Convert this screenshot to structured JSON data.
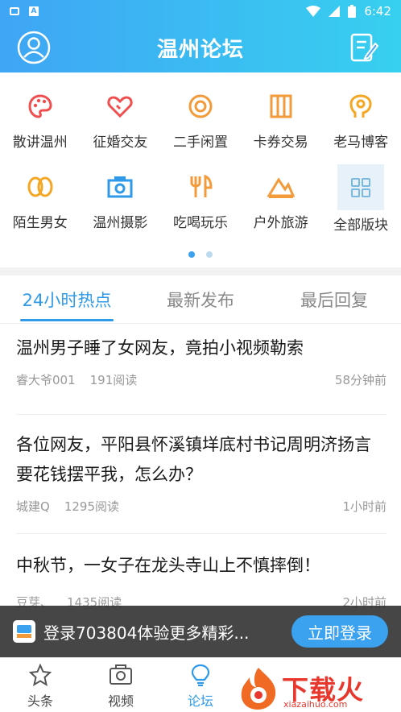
{
  "status_bar": {
    "time": "6:42"
  },
  "header": {
    "title": "温州论坛"
  },
  "categories": [
    {
      "label": "散讲温州",
      "icon": "palette-icon",
      "color": "#ef4f4f"
    },
    {
      "label": "征婚交友",
      "icon": "heart-icon",
      "color": "#ef4f4f"
    },
    {
      "label": "二手闲置",
      "icon": "target-icon",
      "color": "#f39a3b"
    },
    {
      "label": "卡券交易",
      "icon": "ticket-icon",
      "color": "#f39a3b"
    },
    {
      "label": "老马博客",
      "icon": "head-icon",
      "color": "#f5a623"
    },
    {
      "label": "陌生男女",
      "icon": "couple-icon",
      "color": "#f5a623"
    },
    {
      "label": "温州摄影",
      "icon": "camera-icon",
      "color": "#2e9ae9"
    },
    {
      "label": "吃喝玩乐",
      "icon": "fork-knife-icon",
      "color": "#f39a3b"
    },
    {
      "label": "户外旅游",
      "icon": "mountain-icon",
      "color": "#f39a3b"
    },
    {
      "label": "全部版块",
      "icon": "grid-icon",
      "color": "#7ab8e0"
    }
  ],
  "tabs": [
    {
      "label": "24小时热点",
      "active": true
    },
    {
      "label": "最新发布",
      "active": false
    },
    {
      "label": "最后回复",
      "active": false
    }
  ],
  "posts": [
    {
      "title": "温州男子睡了女网友，竟拍小视频勒索",
      "author": "睿大爷001",
      "reads": "191阅读",
      "time": "58分钟前"
    },
    {
      "title": "各位网友，平阳县怀溪镇垟底村书记周明济扬言要花钱摆平我，怎么办？",
      "author": "城建Q",
      "reads": "1295阅读",
      "time": "1小时前"
    },
    {
      "title": "中秋节，一女子在龙头寺山上不慎摔倒！",
      "author": "豆芽、",
      "reads": "1435阅读",
      "time": "2小时前"
    }
  ],
  "banner": {
    "text": "登录703804体验更多精彩...",
    "button": "立即登录"
  },
  "bottom_nav": [
    {
      "label": "头条",
      "icon": "star-icon",
      "active": false
    },
    {
      "label": "视频",
      "icon": "video-icon",
      "active": false
    },
    {
      "label": "论坛",
      "icon": "bulb-icon",
      "active": true
    }
  ],
  "watermark": {
    "text": "下载火",
    "sub": "xiazaihuo.com"
  },
  "colors": {
    "primary": "#2e9ae9",
    "header_start": "#3fa5f5",
    "header_end": "#37d0ef"
  }
}
